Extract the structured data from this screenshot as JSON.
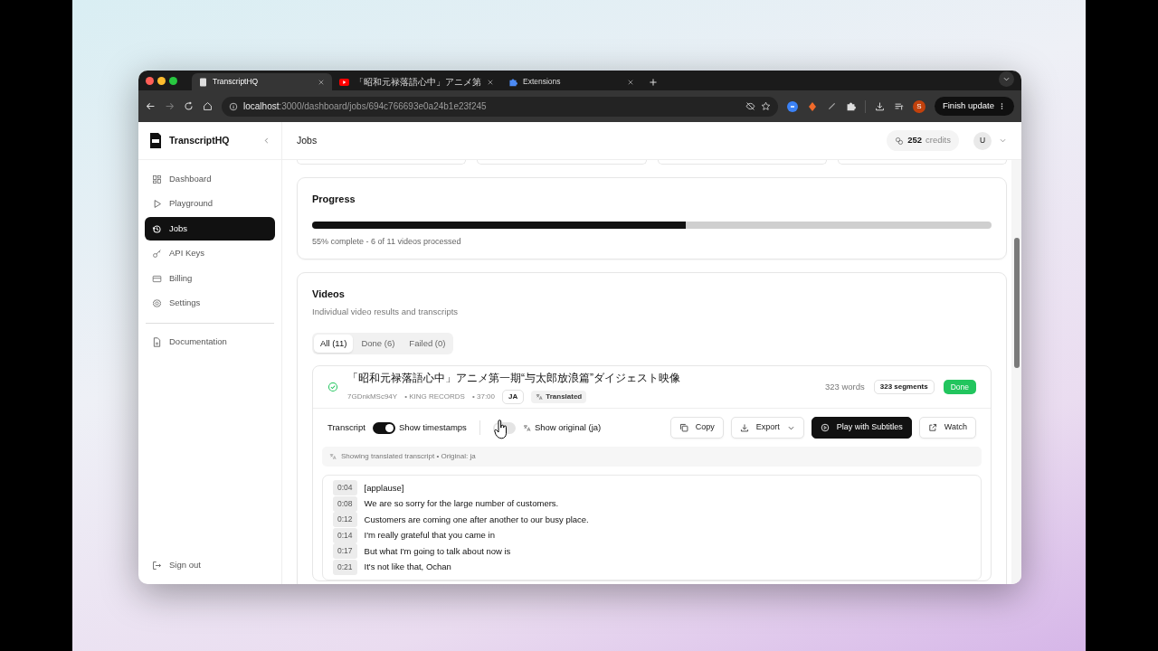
{
  "browser": {
    "tabs": [
      {
        "title": "TranscriptHQ",
        "selected": true
      },
      {
        "title": "「昭和元禄落語心中」アニメ第",
        "selected": false
      },
      {
        "title": "Extensions",
        "selected": false
      }
    ],
    "address": {
      "host": "localhost",
      "path": ":3000/dashboard/jobs/694c766693e0a24b1e23f245"
    },
    "profile": "S",
    "update_button": "Finish update"
  },
  "sidebar": {
    "brand": "TranscriptHQ",
    "items": [
      {
        "label": "Dashboard",
        "selected": false
      },
      {
        "label": "Playground",
        "selected": false
      },
      {
        "label": "Jobs",
        "selected": true
      },
      {
        "label": "API Keys",
        "selected": false
      },
      {
        "label": "Billing",
        "selected": false
      },
      {
        "label": "Settings",
        "selected": false
      }
    ],
    "secondary": [
      {
        "label": "Documentation"
      }
    ],
    "sign_out": "Sign out"
  },
  "header": {
    "title": "Jobs",
    "credits": "252",
    "credits_label": "credits",
    "avatar": "U"
  },
  "progress": {
    "title": "Progress",
    "level": 0.55,
    "caption": "55% complete - 6 of 11 videos processed"
  },
  "videos": {
    "title": "Videos",
    "subtitle": "Individual video results and transcripts",
    "filters": [
      {
        "label": "All (11)",
        "selected": true
      },
      {
        "label": "Done (6)",
        "selected": false
      },
      {
        "label": "Failed (0)",
        "selected": false
      }
    ],
    "video": {
      "title": "「昭和元禄落語心中」アニメ第一期“与太郎放浪篇”ダイジェスト映像",
      "video_id": "7GDnkMSc94Y",
      "channel": "• KING RECORDS",
      "duration": "• 37:00",
      "language": "JA",
      "translated": "Translated",
      "words": "323 words",
      "segments": "323 segments",
      "status": "Done",
      "transcript_label": "Transcript",
      "toggles": [
        {
          "label": "Show timestamps",
          "on": true
        },
        {
          "label": "Show original (ja)",
          "on": false
        }
      ],
      "actions": [
        {
          "label": "Copy",
          "kind": "outline",
          "dropdown": false
        },
        {
          "label": "Export",
          "kind": "outline",
          "dropdown": true
        },
        {
          "label": "Play with Subtitles",
          "kind": "dark",
          "dropdown": false
        },
        {
          "label": "Watch",
          "kind": "outline",
          "dropdown": false
        }
      ],
      "note": "Showing translated transcript • Original: ja",
      "lines": [
        {
          "time": "0:04",
          "text": "[applause]"
        },
        {
          "time": "0:08",
          "text": "We are so sorry for the large number of customers."
        },
        {
          "time": "0:12",
          "text": "Customers are coming one after another to our busy place."
        },
        {
          "time": "0:14",
          "text": "I'm really grateful that you came in"
        },
        {
          "time": "0:17",
          "text": "But what I'm going to talk about now is"
        },
        {
          "time": "0:21",
          "text": "It's not like that, Ochan"
        }
      ]
    }
  }
}
